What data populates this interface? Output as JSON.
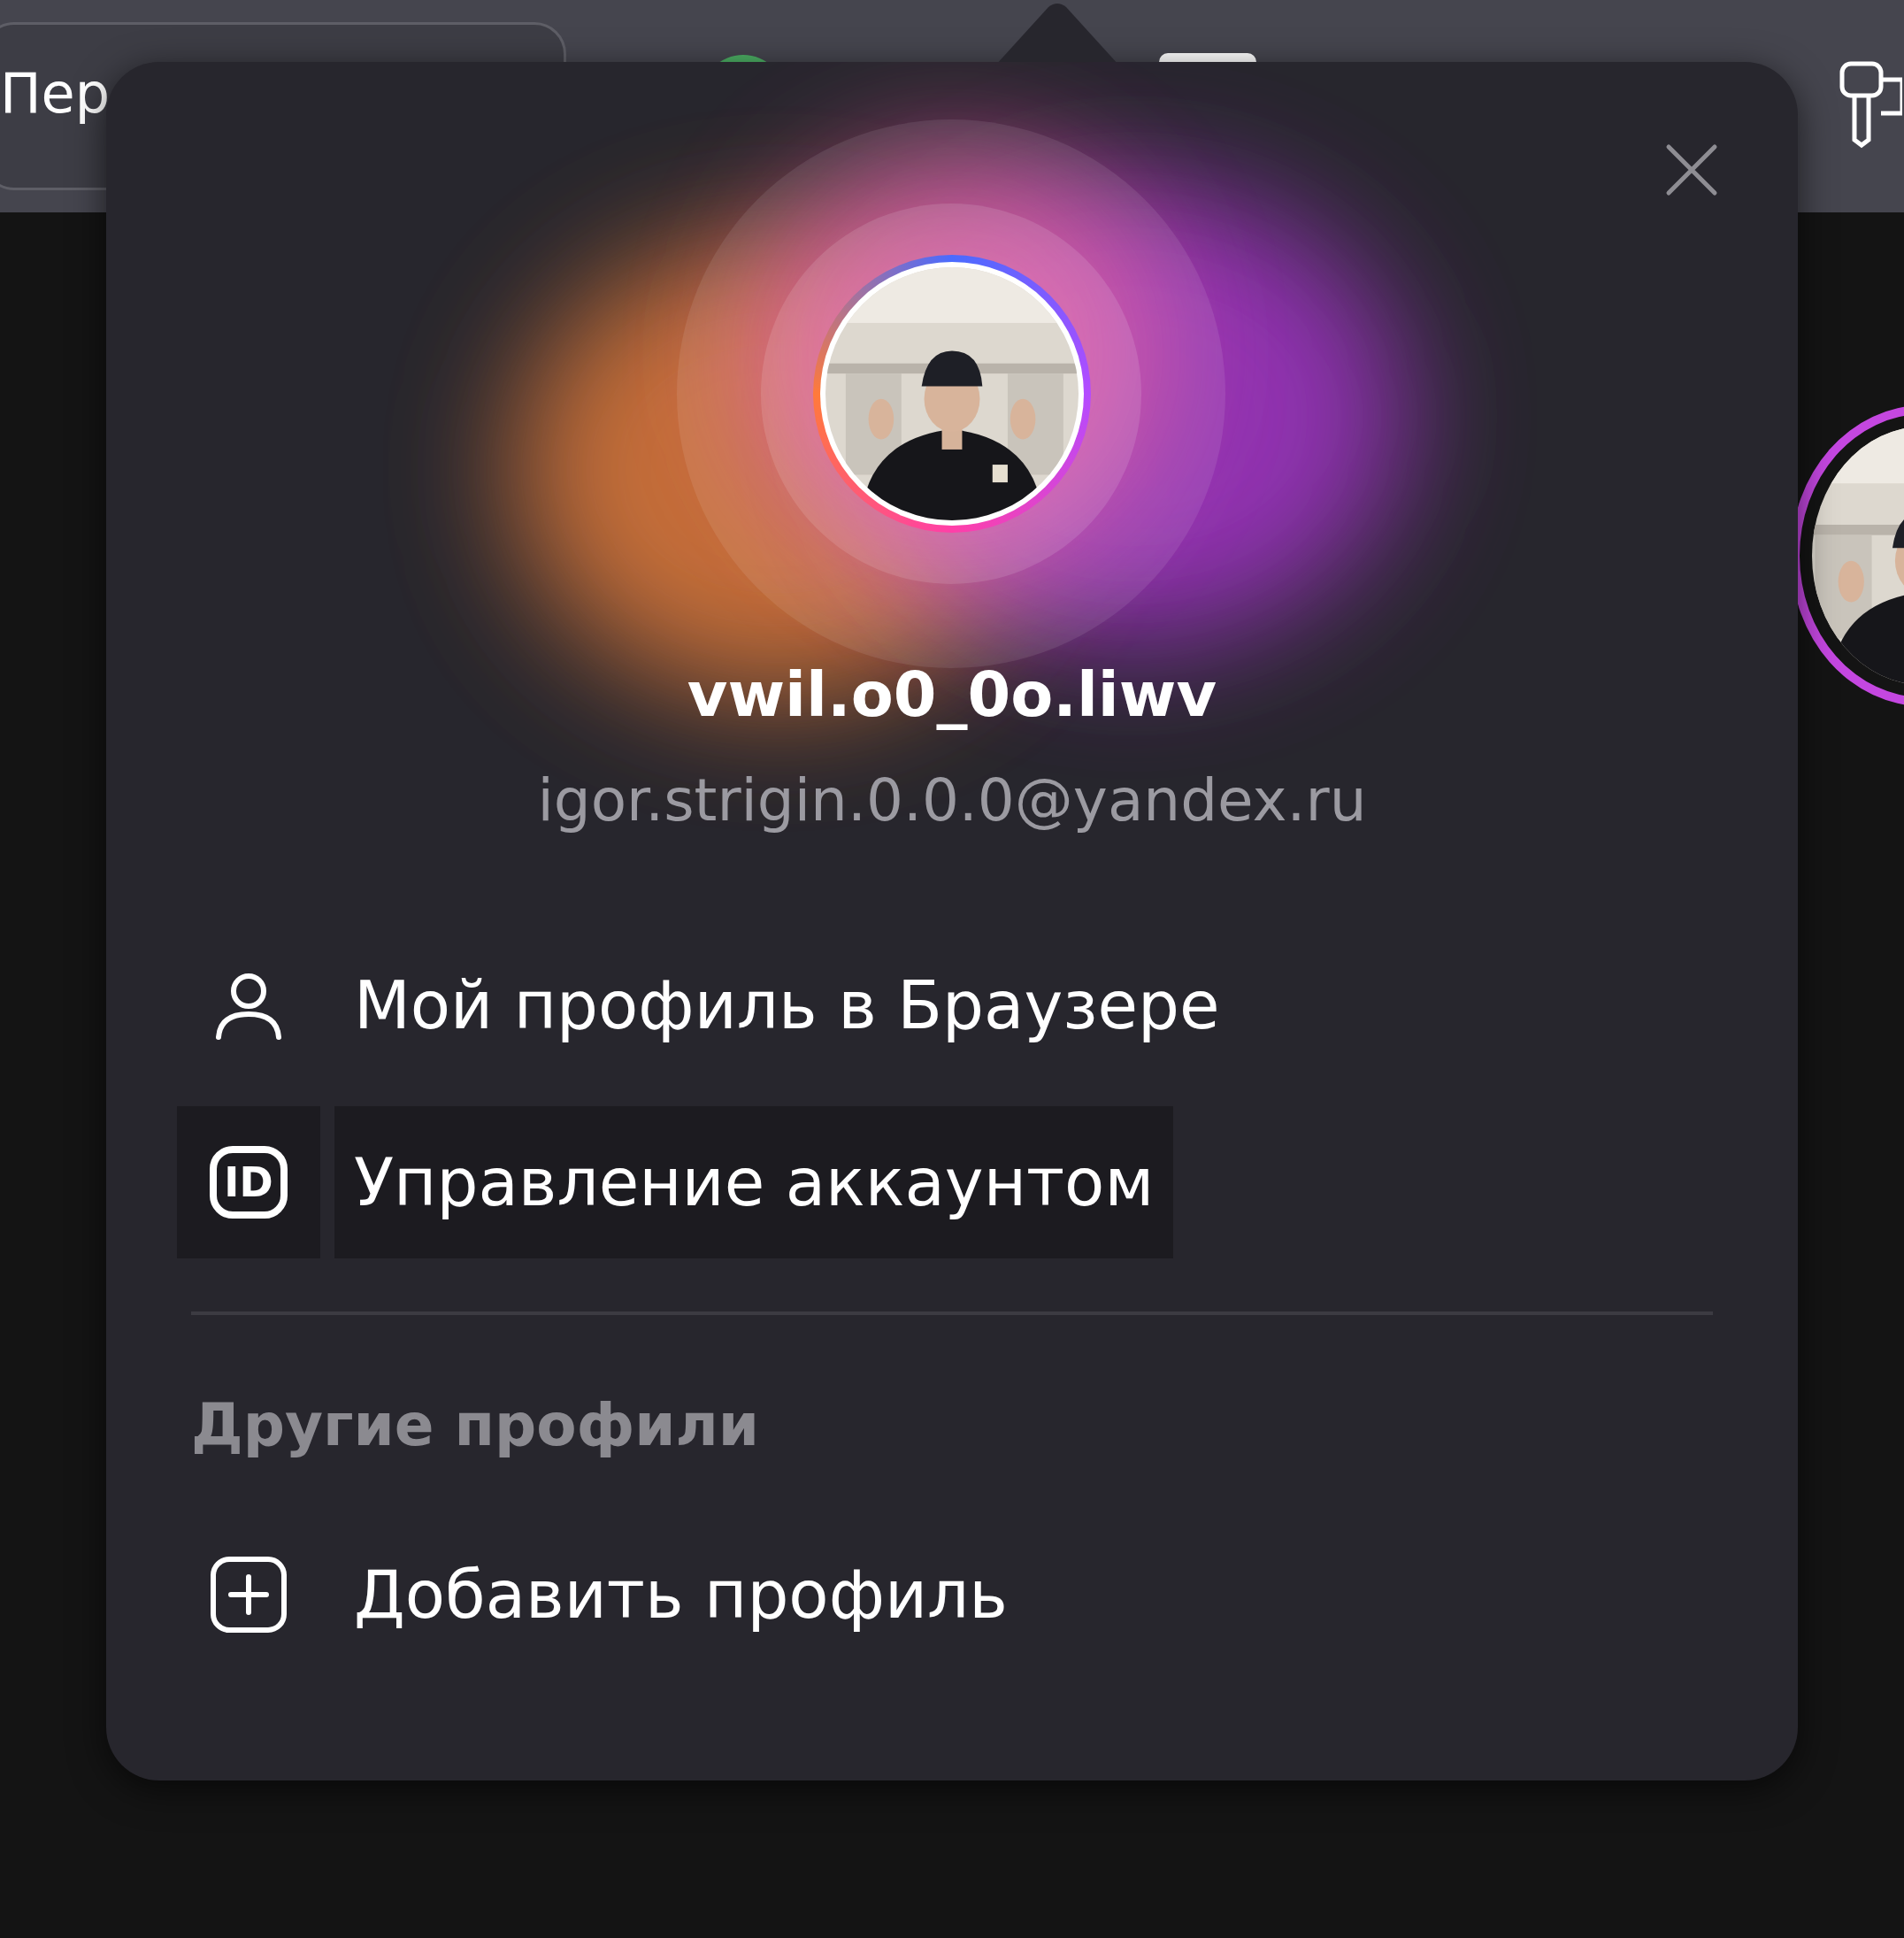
{
  "toolbar": {
    "tab_text": "Пер"
  },
  "popup": {
    "profile": {
      "username": "vwil.o0_0o.liwv",
      "email": "igor.strigin.0.0.0@yandex.ru"
    },
    "menu": [
      {
        "label": "Мой профиль в Браузере",
        "kind": "person",
        "highlighted": false
      },
      {
        "label": "Управление аккаунтом",
        "kind": "id",
        "badge": "ID",
        "highlighted": true
      }
    ],
    "section_title": "Другие профили",
    "other_profiles": [
      {
        "label": "Добавить профиль",
        "kind": "plus",
        "highlighted": false
      }
    ]
  }
}
